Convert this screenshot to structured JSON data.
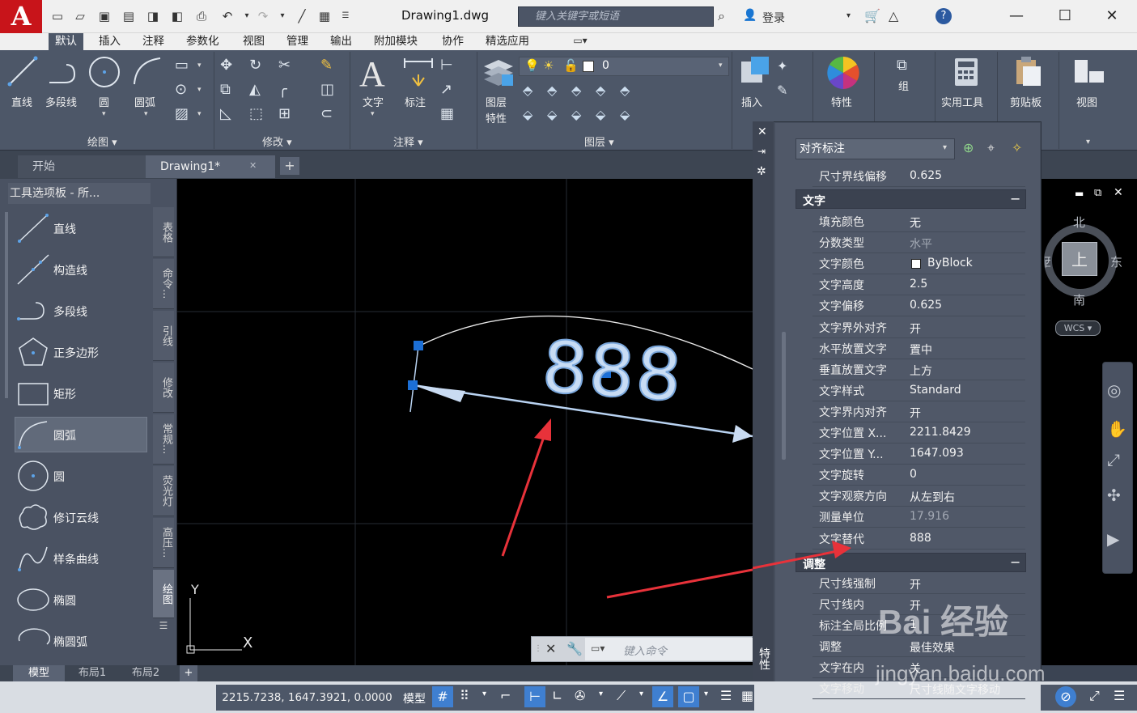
{
  "title_bar": {
    "app_logo": "A",
    "doc_title": "Drawing1.dwg",
    "search_placeholder": "键入关键字或短语",
    "login_label": "登录",
    "minimize": "—",
    "maximize": "☐",
    "close": "✕"
  },
  "ribbon_tabs": [
    "默认",
    "插入",
    "注释",
    "参数化",
    "视图",
    "管理",
    "输出",
    "附加模块",
    "协作",
    "精选应用"
  ],
  "ribbon": {
    "draw": {
      "line": "直线",
      "polyline": "多段线",
      "circle": "圆",
      "arc": "圆弧",
      "panel": "绘图 ▾"
    },
    "modify": {
      "panel": "修改 ▾"
    },
    "annotation": {
      "text": "文字",
      "dimension": "标注",
      "panel": "注释 ▾"
    },
    "layers": {
      "layer_props": "图层",
      "layer_props2": "特性",
      "current_layer": "0",
      "panel": "图层 ▾"
    },
    "block": {
      "insert": "插入"
    },
    "properties": {
      "label": "特性"
    },
    "groups": {
      "label": "组"
    },
    "utilities": {
      "label": "实用工具"
    },
    "clipboard": {
      "label": "剪贴板"
    },
    "view": {
      "label": "视图"
    }
  },
  "drawing_tabs": {
    "start": "开始",
    "drawing": "Drawing1*",
    "close": "✕",
    "add": "+"
  },
  "palette": {
    "title": "工具选项板 - 所...",
    "items": [
      "直线",
      "构造线",
      "多段线",
      "正多边形",
      "矩形",
      "圆弧",
      "圆",
      "修订云线",
      "样条曲线",
      "椭圆",
      "椭圆弧"
    ],
    "side_tabs": [
      "表格",
      "命令...",
      "引线",
      "修改",
      "常规...",
      "荧光灯",
      "高压...",
      "绘图"
    ]
  },
  "canvas": {
    "dim_text": "888",
    "axis_y": "Y",
    "axis_x": "X",
    "command_placeholder": "键入命令"
  },
  "viewcube": {
    "north": "北",
    "south": "南",
    "east": "东",
    "west": "西",
    "face": "上",
    "wcs": "WCS ▾"
  },
  "properties": {
    "selector": "对齐标注",
    "rows_top": [
      {
        "key": "尺寸界线偏移",
        "value": "0.625",
        "dim": false
      }
    ],
    "section_text": "文字",
    "section_text_toggle": "−",
    "rows_text": [
      {
        "key": "填充颜色",
        "value": "无",
        "dim": false
      },
      {
        "key": "分数类型",
        "value": "水平",
        "dim": true
      },
      {
        "key": "文字颜色",
        "value": "ByBlock",
        "dim": false
      },
      {
        "key": "文字高度",
        "value": "2.5",
        "dim": false
      },
      {
        "key": "文字偏移",
        "value": "0.625",
        "dim": false
      },
      {
        "key": "文字界外对齐",
        "value": "开",
        "dim": false
      },
      {
        "key": "水平放置文字",
        "value": "置中",
        "dim": false
      },
      {
        "key": "垂直放置文字",
        "value": "上方",
        "dim": false
      },
      {
        "key": "文字样式",
        "value": "Standard",
        "dim": false
      },
      {
        "key": "文字界内对齐",
        "value": "开",
        "dim": false
      },
      {
        "key": "文字位置 X...",
        "value": "2211.8429",
        "dim": false
      },
      {
        "key": "文字位置 Y...",
        "value": "1647.093",
        "dim": false
      },
      {
        "key": "文字旋转",
        "value": "0",
        "dim": false
      },
      {
        "key": "文字观察方向",
        "value": "从左到右",
        "dim": false
      },
      {
        "key": "测量单位",
        "value": "17.916",
        "dim": true
      },
      {
        "key": "文字替代",
        "value": "888",
        "dim": false
      }
    ],
    "section_adjust": "调整",
    "section_adjust_toggle": "−",
    "rows_adjust": [
      {
        "key": "尺寸线强制",
        "value": "开",
        "dim": false
      },
      {
        "key": "尺寸线内",
        "value": "开",
        "dim": false
      },
      {
        "key": "标注全局比例",
        "value": "1",
        "dim": false
      },
      {
        "key": "调整",
        "value": "最佳效果",
        "dim": false
      },
      {
        "key": "文字在内",
        "value": "关",
        "dim": false
      },
      {
        "key": "文字移动",
        "value": "尺寸线随文字移动",
        "dim": false
      }
    ],
    "side_label": "特性"
  },
  "layout_tabs": [
    "模型",
    "布局1",
    "布局2",
    "+"
  ],
  "status": {
    "coords": "2215.7238, 1647.3921, 0.0000",
    "model": "模型"
  },
  "watermark": {
    "main": "Bai 经验",
    "sub": "jingyan.baidu.com"
  },
  "colors": {
    "accent": "#4d5768",
    "canvas": "#000000",
    "arrow": "#e8323a",
    "dim_line": "#b9d3f2",
    "grip": "#1c6fd6"
  }
}
